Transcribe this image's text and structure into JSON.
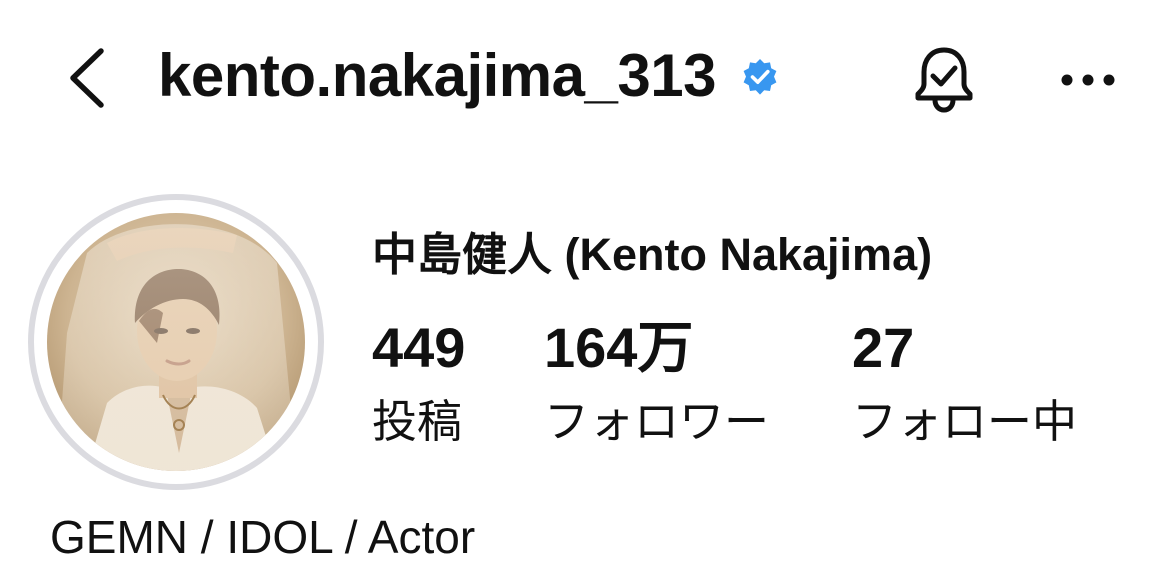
{
  "header": {
    "back_icon": "chevron-left-icon",
    "username": "kento.nakajima_313",
    "verified_icon": "verified-badge-icon",
    "verified_color": "#3897f0",
    "bell_icon": "notification-bell-check-icon",
    "more_icon": "more-horizontal-icon"
  },
  "profile": {
    "avatar_icon": "profile-photo",
    "full_name": "中島健人 (Kento Nakajima)",
    "stats": [
      {
        "value": "449",
        "label": "投稿"
      },
      {
        "value": "164万",
        "label": "フォロワー"
      },
      {
        "value": "27",
        "label": "フォロー中"
      }
    ],
    "bio": "GEMN / IDOL / Actor"
  }
}
